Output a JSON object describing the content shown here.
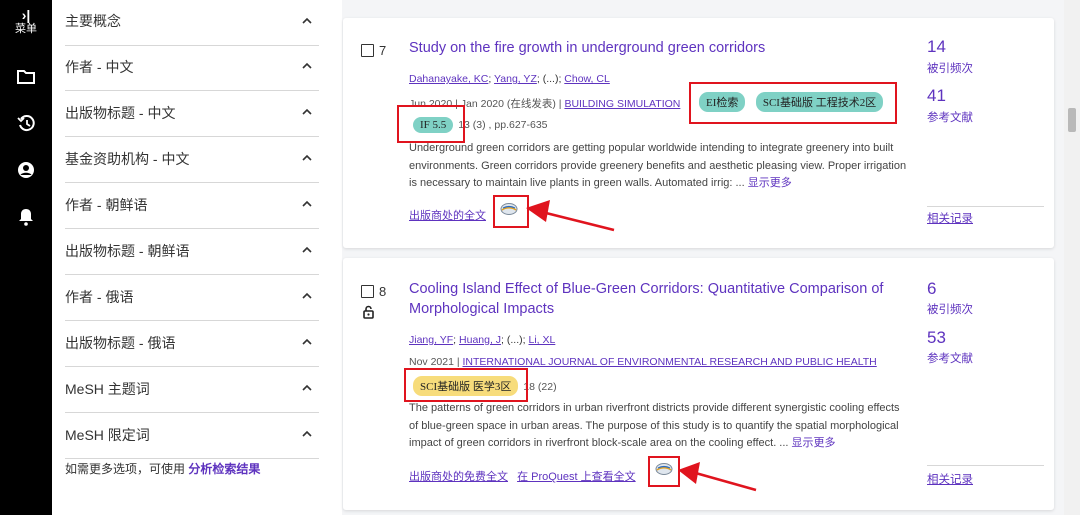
{
  "nav": {
    "menu_label": "菜单",
    "icons": [
      "collapse-icon",
      "folder-icon",
      "history-icon",
      "user-icon",
      "bell-icon"
    ]
  },
  "facets": {
    "items": [
      {
        "label": "主要概念"
      },
      {
        "label": "作者 - 中文"
      },
      {
        "label": "出版物标题 - 中文"
      },
      {
        "label": "基金资助机构 - 中文"
      },
      {
        "label": "作者 - 朝鲜语"
      },
      {
        "label": "出版物标题 - 朝鲜语"
      },
      {
        "label": "作者 - 俄语"
      },
      {
        "label": "出版物标题 - 俄语"
      },
      {
        "label": "MeSH 主题词"
      },
      {
        "label": "MeSH 限定词"
      }
    ],
    "note_prefix": "如需更多选项，可使用",
    "note_link": "分析检索结果"
  },
  "records": [
    {
      "index": "7",
      "title": "Study on the fire growth in underground green corridors",
      "authors": [
        "Dahanayake, KC",
        "Yang, YZ",
        "(...)",
        "Chow, CL"
      ],
      "date": "Jun 2020 | Jan 2020 (在线发表) |",
      "journal": "BUILDING SIMULATION",
      "badges": [
        "EI检索",
        "SCI基础版 工程技术2区"
      ],
      "if_badge": "IF 5.5",
      "volume": "13 (3) , pp.627-635",
      "abstract": "Underground green corridors are getting popular worldwide intending to integrate greenery into built environments. Green corridors provide greenery benefits and aesthetic pleasing view. Proper irrigation is necessary to maintain live plants in green walls. Automated irrig: ...",
      "show_more": "显示更多",
      "link1": "出版商处的全文",
      "times_cited": "14",
      "times_cited_label": "被引频次",
      "references": "41",
      "references_label": "参考文献",
      "related": "相关记录"
    },
    {
      "index": "8",
      "title": "Cooling Island Effect of Blue-Green Corridors: Quantitative Comparison of Morphological Impacts",
      "authors": [
        "Jiang, YF",
        "Huang, J",
        "(...)",
        "Li, XL"
      ],
      "date": "Nov 2021 |",
      "journal": "INTERNATIONAL JOURNAL OF ENVIRONMENTAL RESEARCH AND PUBLIC HEALTH",
      "badges": [
        "SCI基础版 医学3区"
      ],
      "volume": "18 (22)",
      "abstract": "The patterns of green corridors in urban riverfront districts provide different synergistic cooling effects of blue-green space in urban areas. The purpose of this study is to quantify the spatial morphological impact of green corridors in riverfront block-scale area on the cooling effect. ...",
      "show_more": "显示更多",
      "link1": "出版商处的免费全文",
      "link2": "在 ProQuest 上查看全文",
      "times_cited": "6",
      "times_cited_label": "被引频次",
      "references": "53",
      "references_label": "参考文献",
      "related": "相关记录"
    }
  ],
  "colors": {
    "accent": "#5e33bf",
    "badge_green": "#7fd1c5",
    "badge_yellow": "#f7dc7b",
    "annotation_red": "#e0141e"
  }
}
